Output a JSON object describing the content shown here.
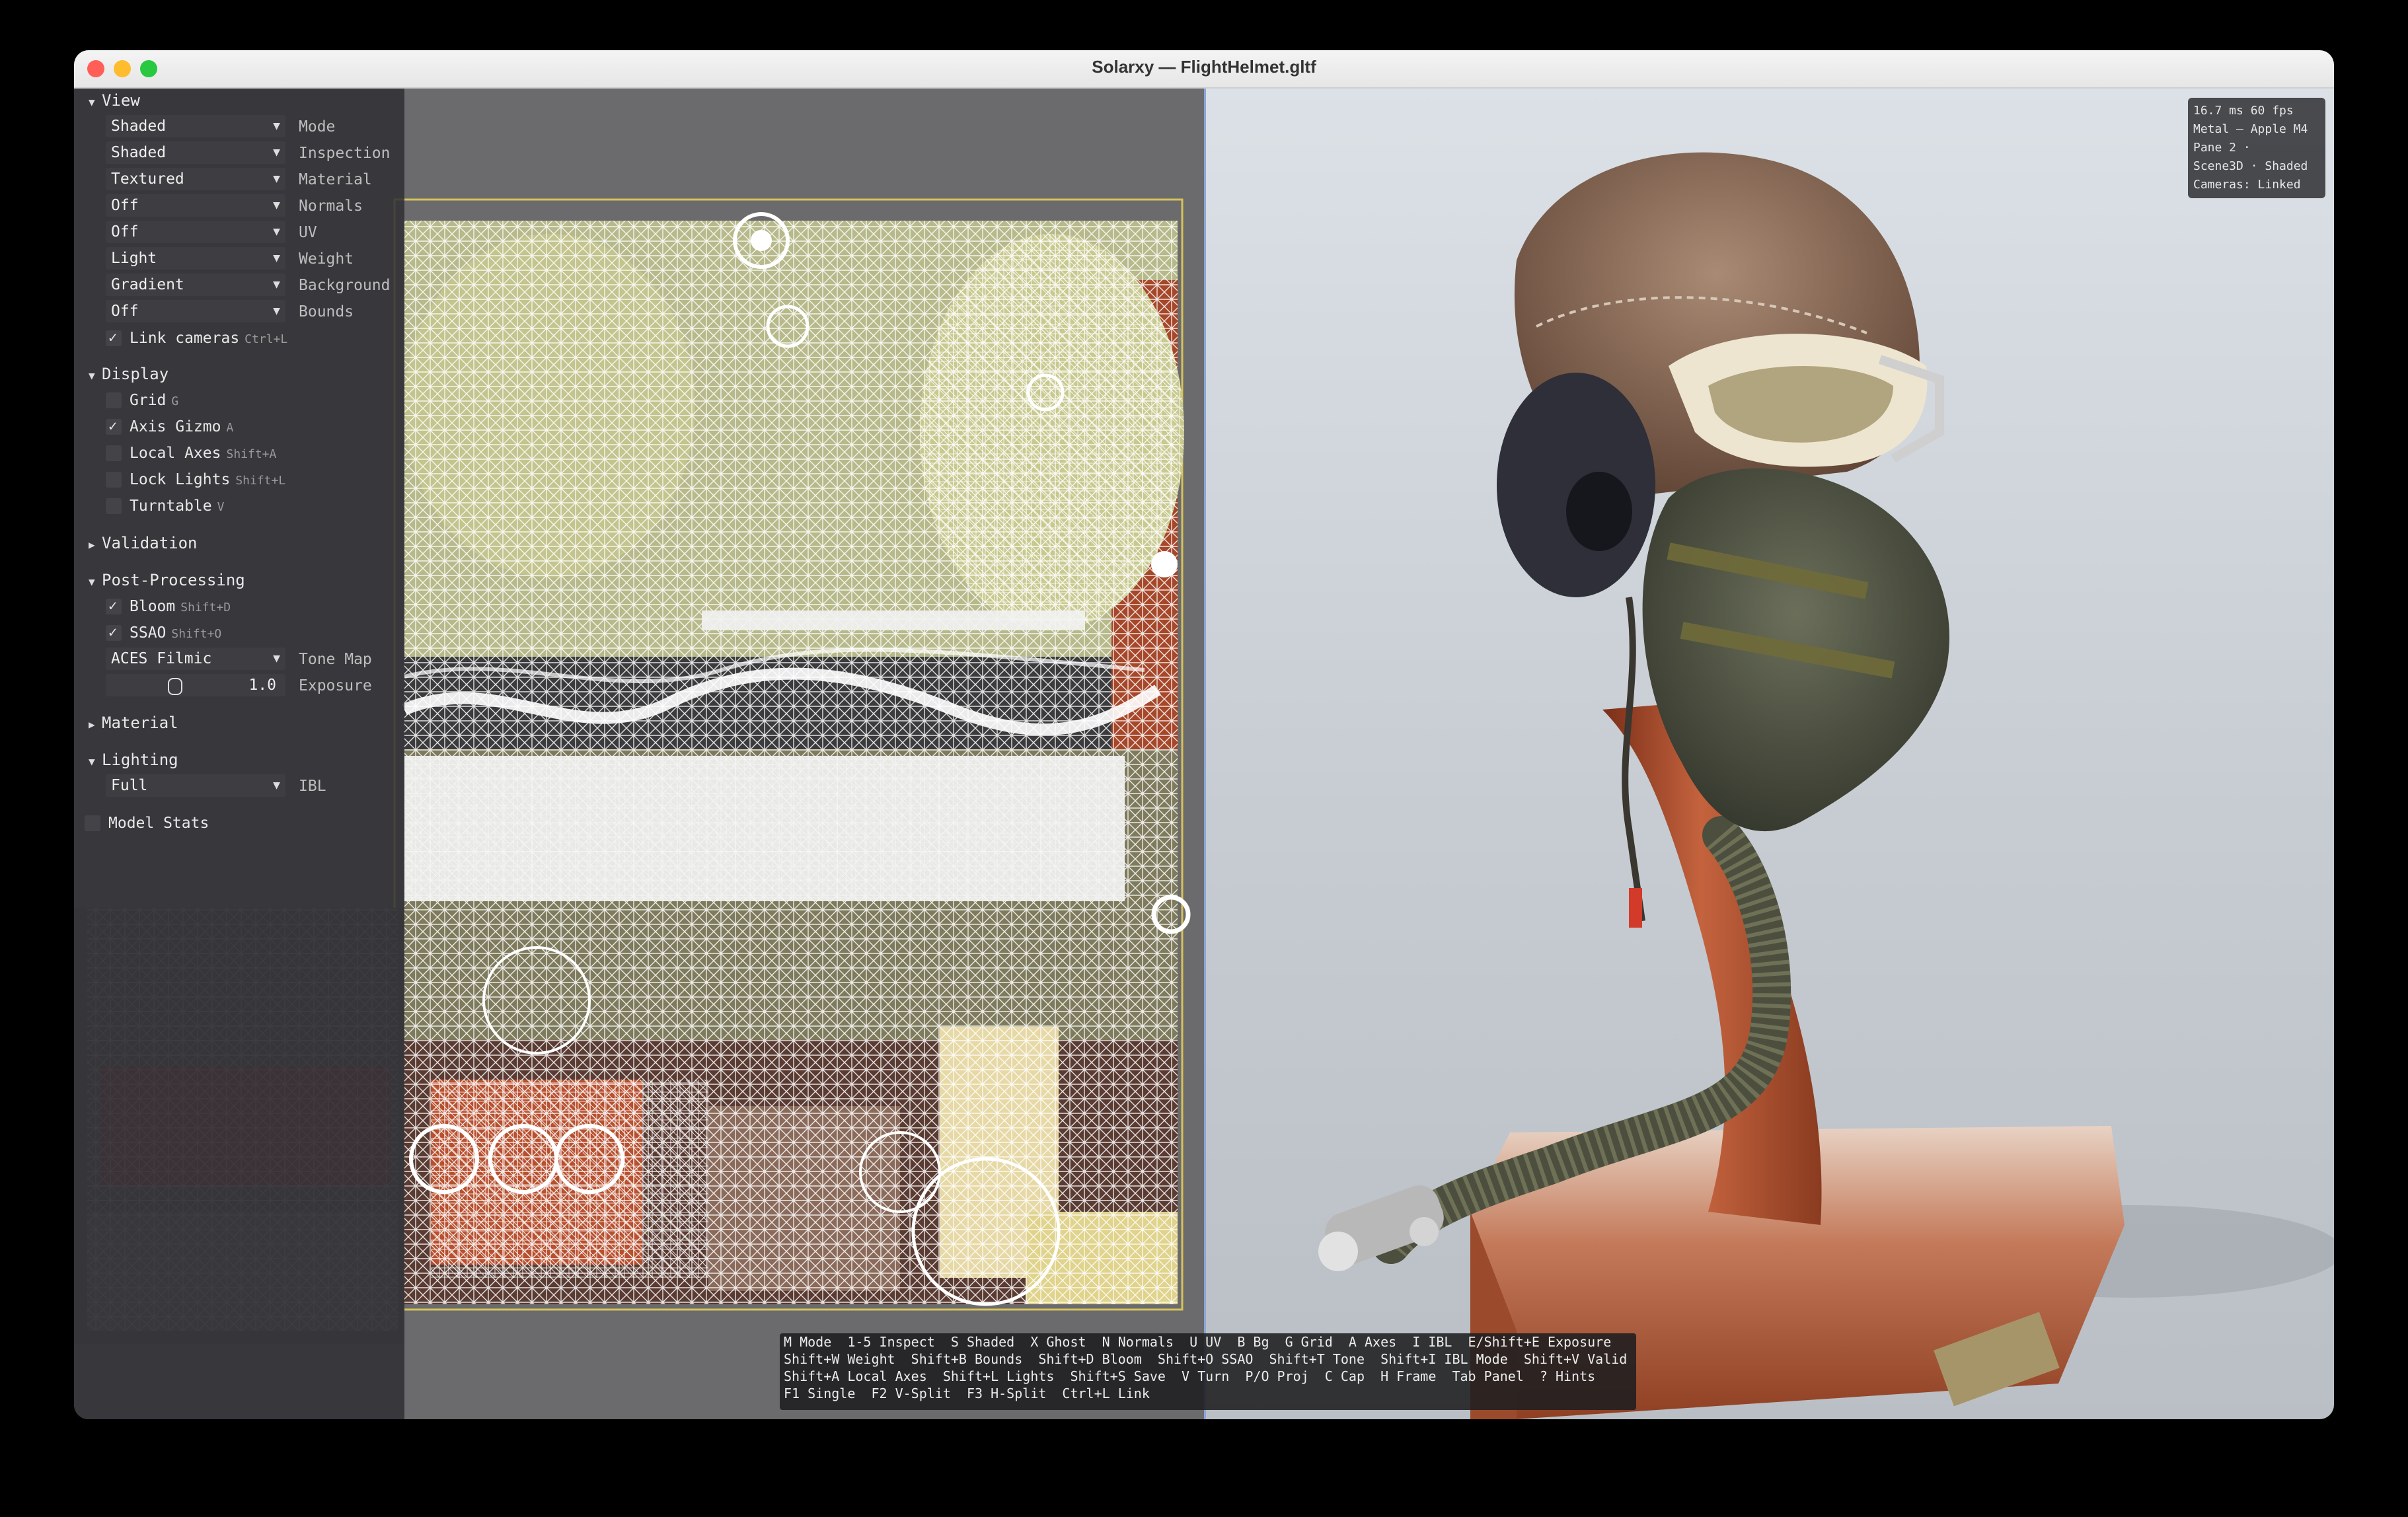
{
  "window": {
    "title": "Solarxy — FlightHelmet.gltf",
    "traffic_lights": {
      "close": "#ff5f57",
      "minimize": "#febc2e",
      "zoom": "#28c840"
    }
  },
  "sidebar": {
    "view": {
      "heading": "View",
      "combos": [
        {
          "value": "Shaded",
          "label": "Mode"
        },
        {
          "value": "Shaded",
          "label": "Inspection"
        },
        {
          "value": "Textured",
          "label": "Material"
        },
        {
          "value": "Off",
          "label": "Normals"
        },
        {
          "value": "Off",
          "label": "UV"
        },
        {
          "value": "Light",
          "label": "Weight"
        },
        {
          "value": "Gradient",
          "label": "Background"
        },
        {
          "value": "Off",
          "label": "Bounds"
        }
      ],
      "link_cameras": {
        "label": "Link cameras",
        "shortcut": "Ctrl+L",
        "checked": true
      }
    },
    "display": {
      "heading": "Display",
      "items": [
        {
          "label": "Grid",
          "shortcut": "G",
          "checked": false
        },
        {
          "label": "Axis Gizmo",
          "shortcut": "A",
          "checked": true
        },
        {
          "label": "Local Axes",
          "shortcut": "Shift+A",
          "checked": false
        },
        {
          "label": "Lock Lights",
          "shortcut": "Shift+L",
          "checked": false
        },
        {
          "label": "Turntable",
          "shortcut": "V",
          "checked": false
        }
      ]
    },
    "validation": {
      "heading": "Validation"
    },
    "post_processing": {
      "heading": "Post-Processing",
      "bloom": {
        "label": "Bloom",
        "shortcut": "Shift+D",
        "checked": true
      },
      "ssao": {
        "label": "SSAO",
        "shortcut": "Shift+O",
        "checked": true
      },
      "tone_map": {
        "value": "ACES Filmic",
        "label": "Tone Map"
      },
      "exposure": {
        "value": "1.0",
        "label": "Exposure"
      }
    },
    "material": {
      "heading": "Material"
    },
    "lighting": {
      "heading": "Lighting",
      "ibl": {
        "value": "Full",
        "label": "IBL"
      }
    },
    "model_stats": {
      "label": "Model Stats"
    }
  },
  "stats": {
    "lines": [
      "16.7 ms  60 fps",
      "Metal — Apple M4",
      "Pane 2 ·",
      "Scene3D · Shaded",
      "Cameras: Linked"
    ]
  },
  "hints": {
    "lines": [
      "M Mode  1-5 Inspect  S Shaded  X Ghost  N Normals  U UV  B Bg  G Grid  A Axes  I IBL  E/Shift+E Exposure",
      "Shift+W Weight  Shift+B Bounds  Shift+D Bloom  Shift+O SSAO  Shift+T Tone  Shift+I IBL Mode  Shift+V Valid",
      "Shift+A Local Axes  Shift+L Lights  Shift+S Save  V Turn  P/O Proj  C Cap  H Frame  Tab Panel  ? Hints",
      "F1 Single  F2 V-Split  F3 H-Split  Ctrl+L Link"
    ]
  },
  "icons": [
    "disclosure-triangle-icon",
    "chevron-down-icon",
    "checkmark-icon"
  ]
}
